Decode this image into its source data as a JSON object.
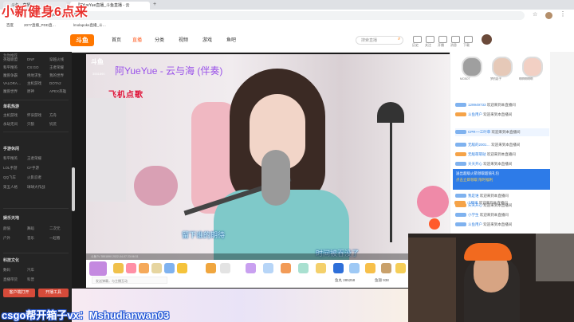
{
  "overlay": {
    "top_text": "小新健身6点来",
    "bottom_text": "csgo帮开箱子vx：Mshudianwan03"
  },
  "browser": {
    "tab1": "斗鱼 - 直播…",
    "tab2": "阿YueYue直播_斗鱼直播 - 云",
    "url": "douyu.com/3551890",
    "bookmarks": [
      "百度",
      "2077直播_PDD直…",
      "lmolapoke直播_斗…"
    ]
  },
  "header": {
    "logo": "斗鱼",
    "nav": [
      "首页",
      "直播",
      "分类",
      "视频",
      "游戏",
      "鱼吧"
    ],
    "active_nav": "直播",
    "search_placeholder": "搜索直播",
    "icons": [
      "历史",
      "关注",
      "开播",
      "消息",
      "下载"
    ]
  },
  "sidebar": {
    "top_label": "为你推荐",
    "section1": [
      "英雄联盟",
      "DNF",
      "穿越火线",
      "和平精英",
      "CS:GO",
      "王者荣耀",
      "魔兽争霸",
      "绝地求生",
      "我的世界",
      "VALORA…",
      "主机游戏",
      "DOTA2",
      "魔兽世界",
      "原神",
      "APEX英雄"
    ],
    "section2_title": "单机热游",
    "section2": [
      "主机游戏",
      "怀旧游戏",
      "方舟",
      "永劫无间",
      "只狼",
      "饥荒"
    ],
    "section3_title": "手游休闲",
    "section3": [
      "和平精英",
      "王者荣耀",
      "LOL手游",
      "CF手游",
      "QQ飞车",
      "火影忍者",
      "第五人格",
      "球球大作战"
    ],
    "section4_title": "娱乐天地",
    "section4": [
      "颜值",
      "舞蹈",
      "二次元",
      "户外",
      "音乐",
      "一起看"
    ],
    "section5_title": "科技文化",
    "section5": [
      "数码",
      "汽车",
      "直播带货",
      "科普"
    ],
    "btn_left": "客户端打开",
    "btn_right": "开播工具"
  },
  "stream": {
    "platform_mark": "斗鱼",
    "room_id": "3551890",
    "title": "阿YueYue - 云与海 (伴奏)",
    "song_request": "飞机点歌",
    "lyric1": "留下谁的期待",
    "lyric2": "时间被吞没了",
    "control_text": "斗鱼TV  3551890  2022-04-07 23:06:31"
  },
  "giftbar": {
    "chat_placeholder": "发送弹幕，与主播互动",
    "fans_label": "鱼丸 285258",
    "fish_label": "鱼翅 938"
  },
  "rightpanel": {
    "rank_names": [
      "MCBOT",
      "梦的影子",
      "啊啊啊啊啊"
    ],
    "chat": [
      {
        "badge": "11",
        "name": "129949733",
        "text": "欢迎来到本直播间"
      },
      {
        "badge": "9",
        "name": "斗鱼用户",
        "text": "欢迎来到本直播间"
      },
      {
        "badge": "7",
        "name": "CPR~~三叶草",
        "text": "欢迎来到本直播间"
      },
      {
        "badge": "14",
        "name": "无敌的2001…",
        "text": "欢迎来到本直播间"
      },
      {
        "badge": "8",
        "name": "无敌萌萌哒",
        "text": "欢迎来到本直播间"
      },
      {
        "badge": "6",
        "name": "天天开心",
        "text": "欢迎来到本直播间"
      },
      {
        "badge": "15",
        "name": "吃嗯嗯嗯",
        "text": "欢迎来到本直播间"
      }
    ],
    "promo_line1": "送出超级火箭领取超值礼包",
    "promo_line2": "点击立即领取 限时福利",
    "chat2": [
      {
        "badge": "12",
        "name": "我是谁",
        "text": "欢迎来到本直播间"
      },
      {
        "badge": "5",
        "name": "天天开心",
        "text": "欢迎来到本直播间"
      },
      {
        "badge": "10",
        "name": "小学生",
        "text": "欢迎来到本直播间"
      },
      {
        "badge": "4",
        "name": "斗鱼用户",
        "text": "欢迎来到本直播间"
      },
      {
        "badge": "9",
        "name": "小糖果",
        "text": "欢迎来到本直播间"
      }
    ]
  }
}
